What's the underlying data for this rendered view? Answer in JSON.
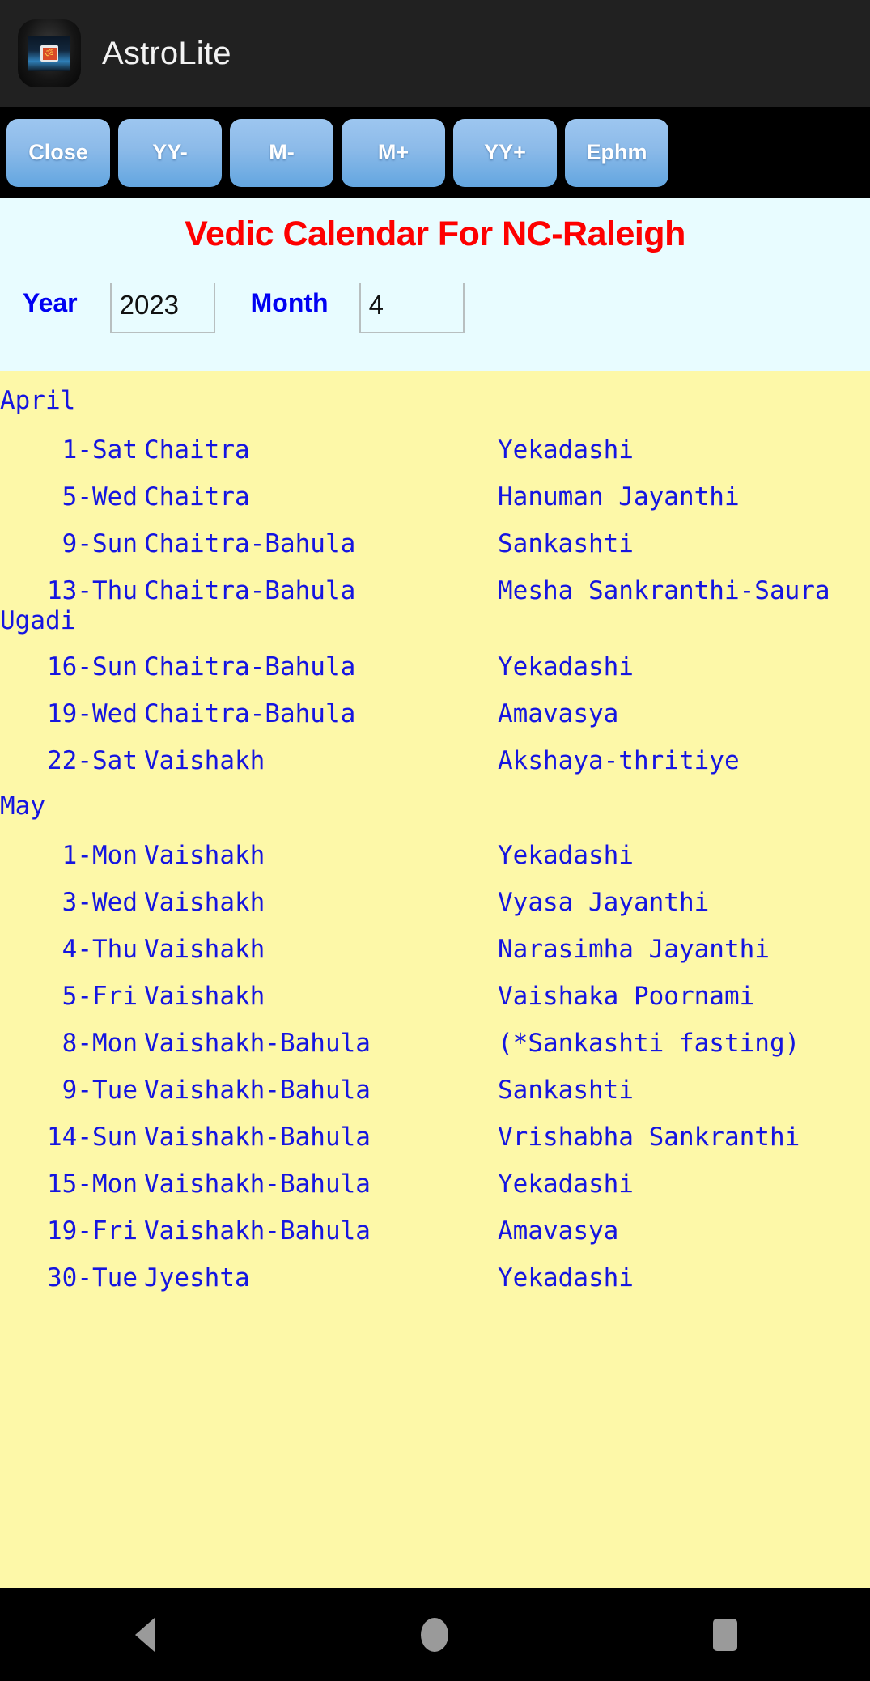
{
  "app": {
    "title": "AstroLite",
    "icon_name": "om-app-icon"
  },
  "toolbar": {
    "buttons": [
      {
        "label": "Close",
        "name": "close-button"
      },
      {
        "label": "YY-",
        "name": "year-decrement-button"
      },
      {
        "label": "M-",
        "name": "month-decrement-button"
      },
      {
        "label": "M+",
        "name": "month-increment-button"
      },
      {
        "label": "YY+",
        "name": "year-increment-button"
      },
      {
        "label": "Ephm",
        "name": "ephemeris-button"
      }
    ]
  },
  "header": {
    "page_title": "Vedic Calendar For NC-Raleigh",
    "title_color": "#fe0000",
    "label_color": "#0000f2",
    "background": "#e8fcff",
    "year_label": "Year",
    "year_value": "2023",
    "year_placeholder": "Year",
    "month_label": "Month",
    "month_value": "4",
    "month_placeholder": "Month"
  },
  "calendar": {
    "background": "#fdf8a8",
    "text_color": "#1515e0",
    "months": [
      {
        "name": "April",
        "rows": [
          {
            "date": "1-Sat",
            "masa": "Chaitra",
            "event": "Yekadashi"
          },
          {
            "date": "5-Wed",
            "masa": "Chaitra",
            "event": "Hanuman Jayanthi"
          },
          {
            "date": "9-Sun",
            "masa": "Chaitra-Bahula",
            "event": "Sankashti"
          },
          {
            "date": "13-Thu",
            "masa": "Chaitra-Bahula",
            "event": "Mesha Sankranthi-Saura",
            "event_cont": "Ugadi"
          },
          {
            "date": "16-Sun",
            "masa": "Chaitra-Bahula",
            "event": "Yekadashi"
          },
          {
            "date": "19-Wed",
            "masa": "Chaitra-Bahula",
            "event": "Amavasya"
          },
          {
            "date": "22-Sat",
            "masa": "Vaishakh",
            "event": "Akshaya-thritiye"
          }
        ]
      },
      {
        "name": "May",
        "rows": [
          {
            "date": "1-Mon",
            "masa": "Vaishakh",
            "event": "Yekadashi"
          },
          {
            "date": "3-Wed",
            "masa": "Vaishakh",
            "event": "Vyasa Jayanthi"
          },
          {
            "date": "4-Thu",
            "masa": "Vaishakh",
            "event": "Narasimha Jayanthi"
          },
          {
            "date": "5-Fri",
            "masa": "Vaishakh",
            "event": "Vaishaka Poornami"
          },
          {
            "date": "8-Mon",
            "masa": "Vaishakh-Bahula",
            "event": "(*Sankashti fasting)"
          },
          {
            "date": "9-Tue",
            "masa": "Vaishakh-Bahula",
            "event": "Sankashti"
          },
          {
            "date": "14-Sun",
            "masa": "Vaishakh-Bahula",
            "event": "Vrishabha Sankranthi"
          },
          {
            "date": "15-Mon",
            "masa": "Vaishakh-Bahula",
            "event": "Yekadashi"
          },
          {
            "date": "19-Fri",
            "masa": "Vaishakh-Bahula",
            "event": "Amavasya"
          },
          {
            "date": "30-Tue",
            "masa": "Jyeshta",
            "event": "Yekadashi"
          }
        ]
      }
    ]
  },
  "system_nav": {
    "back_label": "Back",
    "home_label": "Home",
    "recents_label": "Recents"
  }
}
